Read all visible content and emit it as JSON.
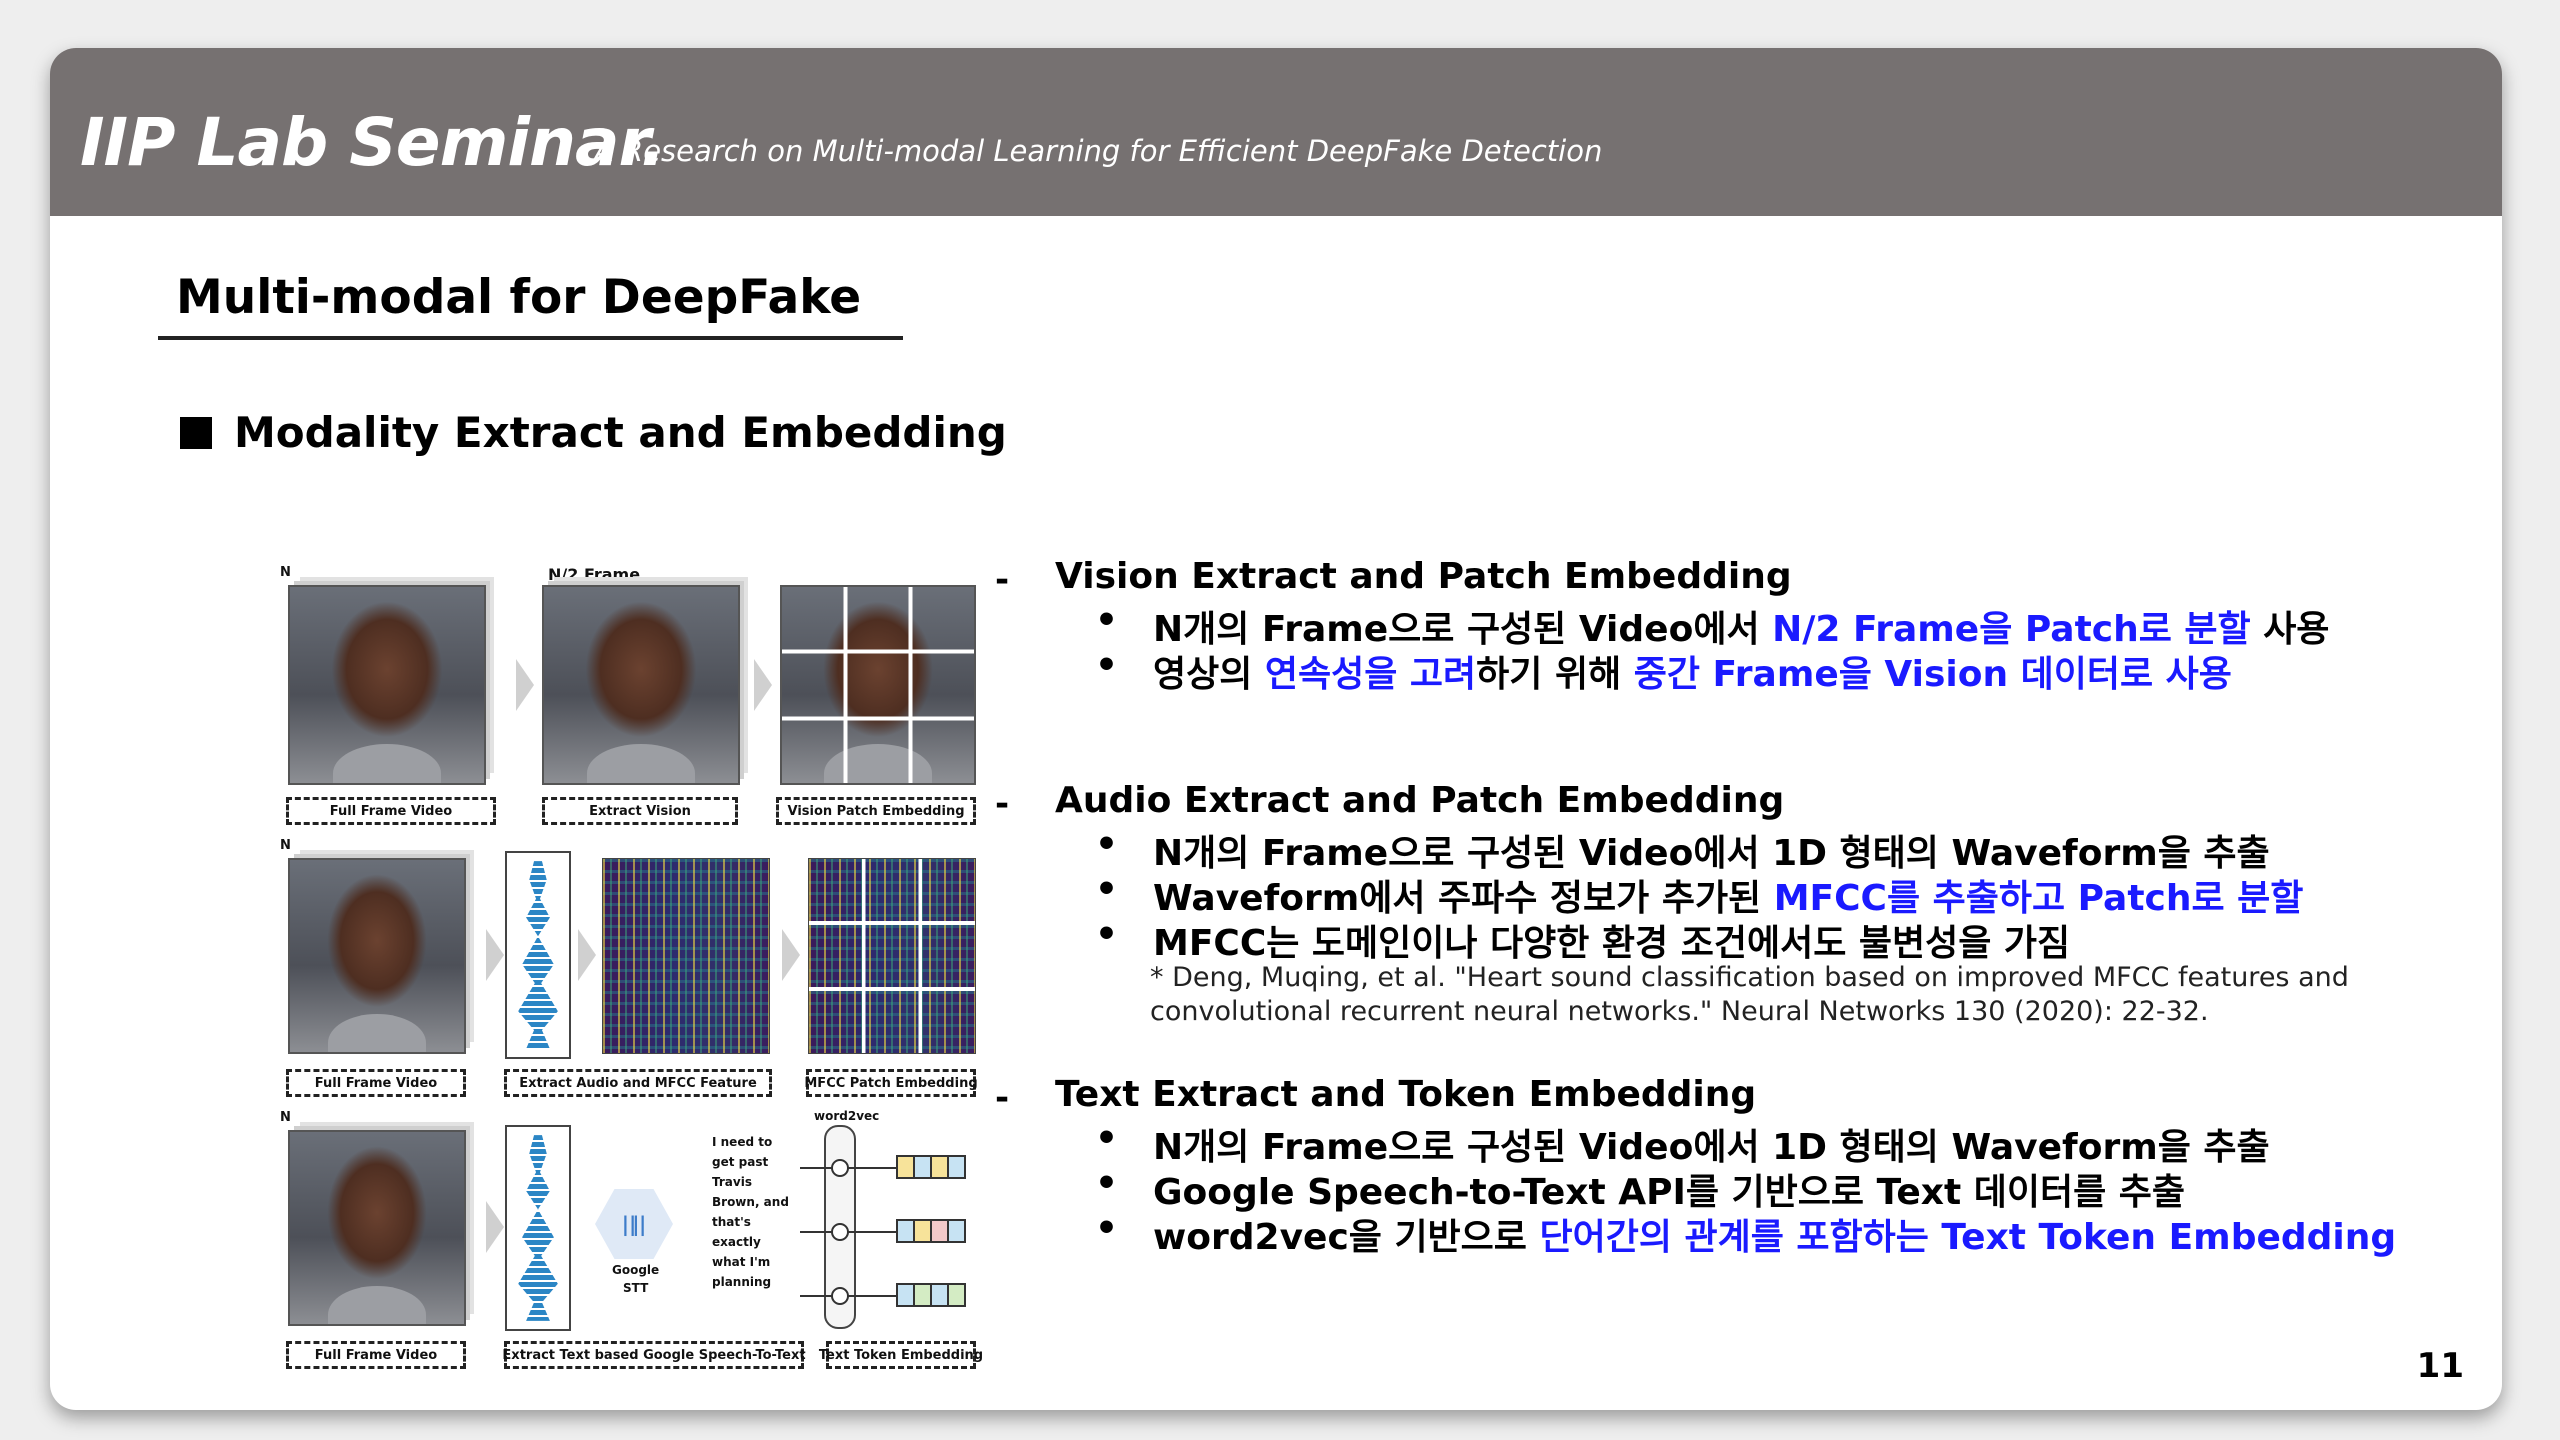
{
  "header": {
    "title": "IIP Lab Seminar.",
    "subtitle": "A Research on Multi-modal Learning for Efficient DeepFake Detection"
  },
  "section_title": "Multi-modal for DeepFake",
  "subsection_title": "Modality Extract and Embedding",
  "figure": {
    "n_label": "N",
    "half_frame_label": "N/2 Frame",
    "row1": {
      "label1": "Full Frame Video",
      "label2": "Extract Vision",
      "label3": "Vision Patch Embedding"
    },
    "row2": {
      "label1": "Full Frame Video",
      "label2": "Extract Audio and MFCC Feature",
      "label3": "MFCC Patch Embedding"
    },
    "row3": {
      "label1": "Full Frame Video",
      "label2": "Extract Text based Google Speech-To-Text",
      "label3": "Text Token Embedding",
      "stt_label1": "Google",
      "stt_label2": "STT",
      "transcript": [
        "I need to",
        "get past",
        "Travis",
        "Brown, and",
        "that's",
        "exactly",
        "what I'm",
        "planning"
      ],
      "word2vec_label": "word2vec"
    }
  },
  "blocks": {
    "vision": {
      "dash": "-",
      "heading": "Vision Extract and Patch Embedding",
      "b1": {
        "p1": "N개의 Frame으로 구성된 Video에서 ",
        "h1": "N/2 Frame을 Patch로 분할",
        "p2": " 사용"
      },
      "b2": {
        "p1": "영상의 ",
        "h1": "연속성을 고려",
        "p2": "하기 위해 ",
        "h2": "중간 Frame을 Vision 데이터로 사용"
      }
    },
    "audio": {
      "dash": "-",
      "heading": "Audio Extract and Patch Embedding",
      "b1": "N개의 Frame으로 구성된 Video에서 1D 형태의 Waveform을 추출",
      "b2": {
        "p1": "Waveform에서 주파수 정보가 추가된 ",
        "h1": "MFCC를 추출하고 Patch로 분할"
      },
      "b3": "MFCC는 도메인이나 다양한 환경 조건에서도 불변성을 가짐",
      "cite1": "* Deng, Muqing, et al. \"Heart sound classification based on improved MFCC features and",
      "cite2": "convolutional recurrent neural networks.\" Neural Networks 130 (2020): 22-32."
    },
    "text": {
      "dash": "-",
      "heading": "Text Extract and Token Embedding",
      "b1": "N개의 Frame으로 구성된 Video에서 1D 형태의 Waveform을 추출",
      "b2": "Google Speech-to-Text API를 기반으로 Text 데이터를 추출",
      "b3": {
        "p1": "word2vec을 기반으로 ",
        "h1": "단어간의 관계를 포함하는 Text Token Embedding"
      }
    },
    "bullet": "•"
  },
  "page_number": "11",
  "colors": {
    "header_bg": "#767171",
    "highlight": "#1a1aff",
    "token_colors": [
      "#f7e39a",
      "#c7e3f3",
      "#d4ecc4",
      "#f3c9c9"
    ]
  }
}
